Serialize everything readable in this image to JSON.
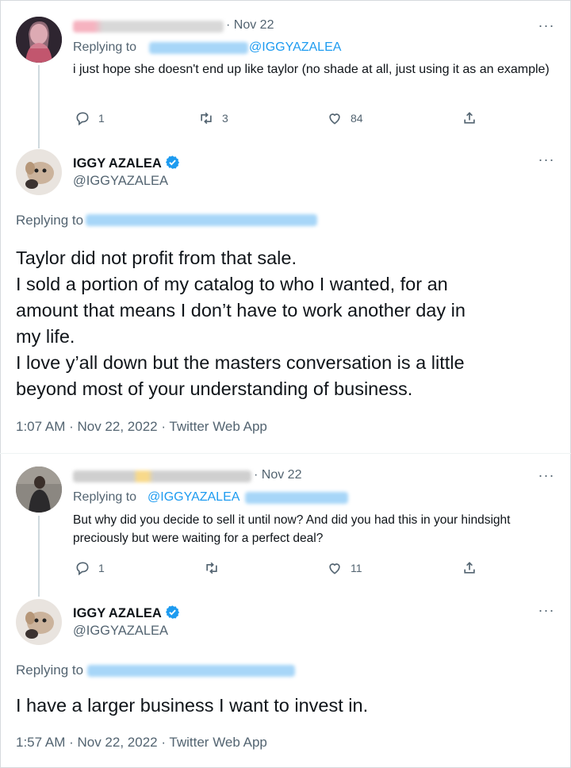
{
  "reply1": {
    "date": "· Nov 22",
    "replying_prefix": "Replying to",
    "mention": "@IGGYAZALEA",
    "text": "i just hope she doesn't end up like taylor (no shade at all, just using it as an example)",
    "replies": "1",
    "retweets": "3",
    "likes": "84"
  },
  "main1": {
    "name": "IGGY AZALEA",
    "handle": "@IGGYAZALEA",
    "replying_prefix": "Replying to",
    "lines": [
      "Taylor did not profit from that sale.",
      "I sold a portion of my catalog to who I wanted, for an",
      "amount that means I don’t have to work another day in",
      "my life.",
      "I love y’all down but the masters conversation is a little",
      "beyond most of your understanding of business."
    ],
    "meta": "1:07 AM · Nov 22, 2022 · Twitter Web App"
  },
  "reply2": {
    "date": "· Nov 22",
    "replying_prefix": "Replying to",
    "mention": "@IGGYAZALEA",
    "text": "But why did you decide to sell it until now? And did you had this in your hindsight preciously but were waiting for a perfect deal?",
    "replies": "1",
    "retweets": "",
    "likes": "11"
  },
  "main2": {
    "name": "IGGY AZALEA",
    "handle": "@IGGYAZALEA",
    "replying_prefix": "Replying to",
    "text": "I have a larger business I want to invest in.",
    "meta": "1:57 AM · Nov 22, 2022 · Twitter Web App"
  },
  "icons": {
    "more": "more-options-icon",
    "reply": "reply-icon",
    "retweet": "retweet-icon",
    "like": "like-icon",
    "share": "share-icon",
    "verified": "verified-badge-icon"
  },
  "colors": {
    "link": "#1d9bf0",
    "muted": "#536471",
    "text": "#0f1419"
  }
}
